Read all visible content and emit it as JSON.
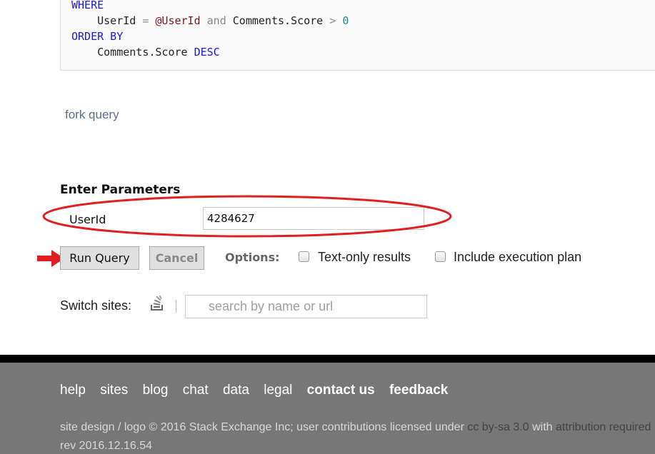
{
  "code": {
    "line1_kw": "WHERE",
    "line2_col": "UserId",
    "line2_eq": "=",
    "line2_var": "@UserId",
    "line2_and": "and",
    "line2_col2": "Comments.Score",
    "line2_gt": ">",
    "line2_num": "0",
    "line3_kw": "ORDER BY",
    "line4_col": "Comments.Score",
    "line4_kw": "DESC"
  },
  "fork_link": "fork query",
  "parameters": {
    "title": "Enter Parameters",
    "userid_label": "UserId",
    "userid_value": "4284627"
  },
  "actions": {
    "run_label": "Run Query",
    "cancel_label": "Cancel",
    "options_label": "Options:",
    "text_only_label": "Text-only results",
    "text_only_checked": false,
    "exec_plan_label": "Include execution plan",
    "exec_plan_checked": false
  },
  "switch_sites": {
    "label": "Switch sites:",
    "icon": "stackexchange-icon",
    "placeholder": "search by name or url"
  },
  "annotations": {
    "ellipse_color": "#e02020",
    "arrow_color": "#e02020"
  },
  "footer": {
    "links": [
      "help",
      "sites",
      "blog",
      "chat",
      "data",
      "legal"
    ],
    "bold_links": [
      "contact us",
      "feedback"
    ],
    "copyright_prefix": "site design / logo © 2016 Stack Exchange Inc; user contributions licensed under",
    "license_link": "cc by-sa 3.0",
    "with_text": "with",
    "attribution_link": "attribution required",
    "rev": "rev 2016.12.16.54"
  }
}
